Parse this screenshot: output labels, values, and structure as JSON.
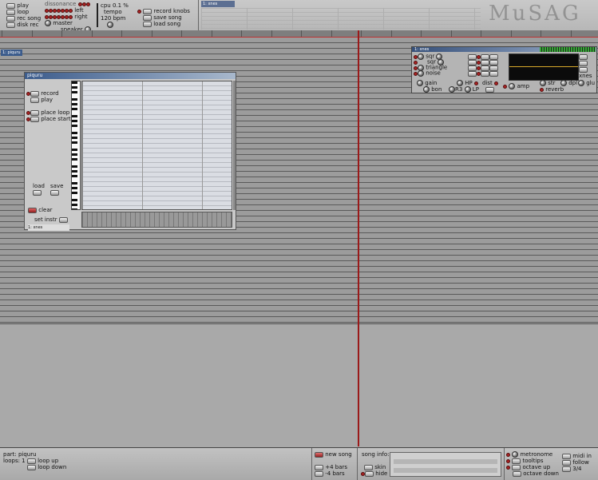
{
  "transport": {
    "play": "play",
    "loop": "loop",
    "rec_song": "rec song",
    "disk_rec": "disk rec"
  },
  "dissonance": {
    "label": "dissonance",
    "left": "left",
    "right": "right"
  },
  "master": {
    "master": "master",
    "speaker": "speaker"
  },
  "cpu": "cpu 0.1 %",
  "tempo": {
    "label": "tempo",
    "value": "120 bpm"
  },
  "knobs_menu": {
    "record_knobs": "record knobs",
    "save_song": "save song",
    "load_song": "load song"
  },
  "instruments": {
    "label": "instruments",
    "selected": "1: xnes"
  },
  "logo": "MuSAG",
  "colors": {
    "playhead": "#9a1a1a",
    "title_blue": "#3c5c8c",
    "led_red": "#a22222"
  },
  "track_label": "1: piquru",
  "piano": {
    "title": "piquru",
    "record": "record",
    "play": "play",
    "place_loop": "place loop",
    "place_start": "place start",
    "load": "load",
    "save": "save",
    "clear": "clear",
    "set_instr": "set instr",
    "instrument": "1: xnes"
  },
  "synth": {
    "title": "1: xnes",
    "sqr1": "sqr",
    "sqr2": "sqr",
    "triangle": "triangle",
    "noise": "noise",
    "gain": "gain",
    "bon": "bon",
    "hp": "HP",
    "lp": "LP",
    "r3": "R3",
    "dist": "dist",
    "amp": "amp",
    "reverb": "reverb",
    "str": "str",
    "dpl": "dpl",
    "glu": "glu",
    "xnes": "xnes"
  },
  "bottom": {
    "part": "part: piquru",
    "loops": "loops: 1",
    "loop_up": "loop up",
    "loop_down": "loop down",
    "new_song": "new song",
    "plus4": "+4 bars",
    "minus4": "-4 bars",
    "song_info": "song info:",
    "skin": "skin",
    "hide": "hide",
    "metronome": "metronome",
    "tooltips": "tooltips",
    "octave_up": "octave up",
    "octave_down": "octave down",
    "midi_in": "midi in",
    "follow": "follow",
    "time_sig": "3/4"
  }
}
